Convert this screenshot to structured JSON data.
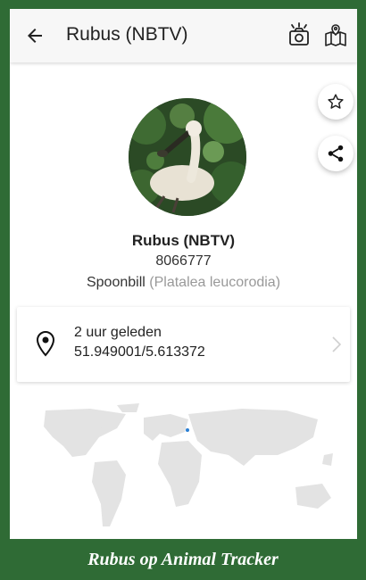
{
  "appbar": {
    "title": "Rubus (NBTV)",
    "icons": [
      "back-arrow-icon",
      "camera-icon",
      "map-icon"
    ]
  },
  "actions": {
    "icons": [
      "star-icon",
      "share-icon"
    ]
  },
  "animal": {
    "name": "Rubus (NBTV)",
    "tag_id": "8066777",
    "species_common": "Spoonbill",
    "species_latin": "(Platalea leucorodia)"
  },
  "location": {
    "time_ago": "2 uur geleden",
    "coordinates": "51.949001/5.613372"
  },
  "colors": {
    "frame_green": "#2f6b35",
    "map_land": "#e3e3e3",
    "marker": "#2a7fd4"
  },
  "caption": "Rubus op Animal Tracker"
}
